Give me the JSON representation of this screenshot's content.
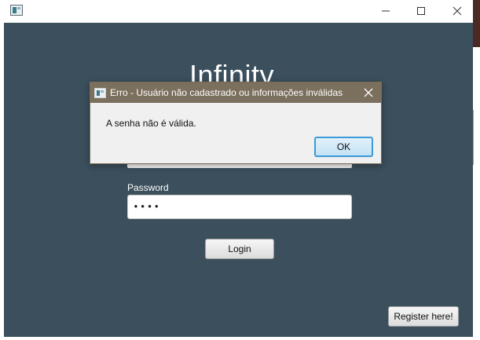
{
  "window": {
    "icon": "app-window-icon",
    "controls": [
      "minimize-icon",
      "maximize-icon",
      "close-icon"
    ]
  },
  "login": {
    "brand": "Infinity",
    "password_label": "Password",
    "password_value": "••••",
    "login_label": "Login",
    "register_label": "Register here!"
  },
  "dialog": {
    "title": "Erro - Usuário não cadastrado ou informações inválidas",
    "message": "A senha não é válida.",
    "ok_label": "OK"
  },
  "colors": {
    "content_bg": "#3b4f5c",
    "dialog_title_bg": "#7b6f5d",
    "ok_border": "#3c9ad6"
  }
}
